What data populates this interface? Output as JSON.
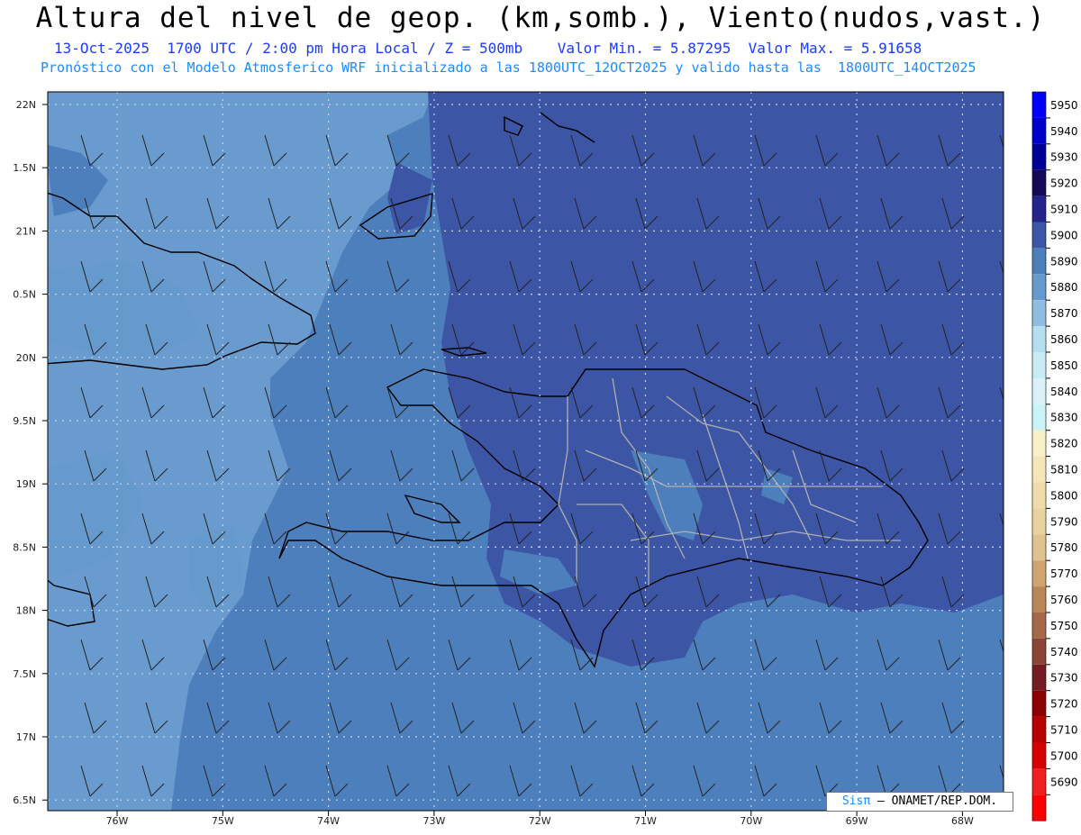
{
  "title": "Altura del nivel de geop. (km,somb.), Viento(nudos,vast.)",
  "subtitle_line1": "13-Oct-2025  1700 UTC / 2:00 pm Hora Local / Z = 500mb    Valor Min. = 5.87295  Valor Max. = 5.91658",
  "subtitle_line2": "Pronóstico con el Modelo Atmosferico WRF inicializado a las 1800UTC_12OCT2025 y valido hasta las  1800UTC_14OCT2025",
  "credit_prefix": "Sisπ",
  "credit_suffix": " – ONAMET/REP.DOM.",
  "lat_labels": [
    "22N",
    "1.5N",
    "21N",
    "0.5N",
    "20N",
    "9.5N",
    "19N",
    "8.5N",
    "18N",
    "7.5N",
    "17N",
    "6.5N"
  ],
  "lon_labels": [
    "76W",
    "75W",
    "74W",
    "73W",
    "72W",
    "71W",
    "70W",
    "69W",
    "68W"
  ],
  "colorbar": {
    "levels": [
      5950,
      5940,
      5930,
      5920,
      5910,
      5900,
      5890,
      5880,
      5870,
      5860,
      5850,
      5840,
      5830,
      5820,
      5810,
      5800,
      5790,
      5780,
      5770,
      5760,
      5750,
      5740,
      5730,
      5720,
      5710,
      5700,
      5690
    ],
    "colors": [
      "#0000ff",
      "#0000cd",
      "#000096",
      "#14085a",
      "#23238c",
      "#3c55a5",
      "#4e7fbd",
      "#6699cc",
      "#8fbce0",
      "#b3e0f0",
      "#c8ebf4",
      "#d9f1f7",
      "#c9f3f6",
      "#f9f0c8",
      "#f5e6b8",
      "#f0dcaa",
      "#e9d29f",
      "#e0c28e",
      "#cfa470",
      "#b98657",
      "#a56848",
      "#8b4536",
      "#731c22",
      "#8c0000",
      "#b90000",
      "#d70000",
      "#f02020",
      "#ff0000"
    ]
  },
  "colors": {
    "sea_dark": "#3c55a5",
    "sea_mid": "#4e7fbd",
    "sea_light": "#6699cc",
    "admin_lines": "#b0b0b0"
  }
}
